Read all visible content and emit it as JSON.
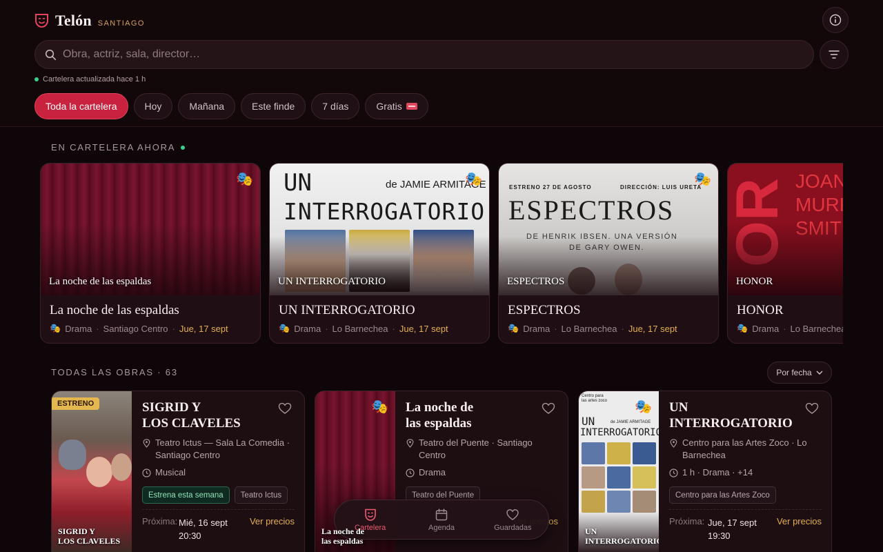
{
  "brand": {
    "name": "Telón",
    "city": "SANTIAGO"
  },
  "search": {
    "placeholder": "Obra, actriz, sala, director…"
  },
  "status": {
    "text": "Cartelera actualizada hace 1 h"
  },
  "filters": [
    {
      "label": "Toda la cartelera",
      "active": true
    },
    {
      "label": "Hoy"
    },
    {
      "label": "Mañana"
    },
    {
      "label": "Este finde"
    },
    {
      "label": "7 días"
    },
    {
      "label": "Gratis"
    }
  ],
  "featured": {
    "heading": "EN CARTELERA AHORA",
    "cards": [
      {
        "poster_title": "La noche de las espaldas",
        "title": "La noche de las espaldas",
        "genre": "Drama",
        "location": "Santiago Centro",
        "date": "Jue, 17 sept"
      },
      {
        "poster_title": "UN INTERROGATORIO",
        "title": "UN INTERROGATORIO",
        "genre": "Drama",
        "location": "Lo Barnechea",
        "date": "Jue, 17 sept",
        "poster_text": {
          "line1": "UN",
          "line2": "INTERROGATORIO",
          "author": "de JAMIE ARMITAGE"
        }
      },
      {
        "poster_title": "ESPECTROS",
        "title": "ESPECTROS",
        "genre": "Drama",
        "location": "Lo Barnechea",
        "date": "Jue, 17 sept",
        "poster_text": {
          "top_left": "ESTRENO 27 DE AGOSTO",
          "top_right": "DIRECCIÓN: LUIS URETA",
          "big": "ESPECTROS",
          "line1": "DE HENRIK IBSEN. UNA VERSIÓN",
          "line2": "DE GARY OWEN."
        }
      },
      {
        "poster_title": "HONOR",
        "title": "HONOR",
        "genre": "Drama",
        "location": "Lo Barnechea",
        "poster_text": {
          "big": "OR",
          "name1": "JOANN",
          "name2": "MURR",
          "name3": "SMITH"
        }
      }
    ]
  },
  "all": {
    "heading": "TODAS LAS OBRAS · 63",
    "sort_label": "Por fecha",
    "cards": [
      {
        "badge": "ESTRENO",
        "poster_title_1": "SIGRID Y",
        "poster_title_2": "LOS CLAVELES",
        "title_1": "SIGRID Y",
        "title_2": "LOS CLAVELES",
        "venue_1": "Teatro Ictus — Sala La Comedia ·",
        "venue_2": "Santiago Centro",
        "extra": "Musical",
        "tags": [
          "Estrena esta semana",
          "Teatro Ictus"
        ],
        "next_label": "Próxima:",
        "next_1": "Mié, 16 sept",
        "next_2": "20:30",
        "prices": "Ver precios"
      },
      {
        "poster_title_1": "La noche de",
        "poster_title_2": "las espaldas",
        "title_1": "La noche de",
        "title_2": "las espaldas",
        "venue_1": "Teatro del Puente · Santiago",
        "venue_2": "Centro",
        "extra": "Drama",
        "tags": [
          "Teatro del Puente"
        ],
        "prices": "Ver precios"
      },
      {
        "poster_title_1": "UN",
        "poster_title_2": "INTERROGATORIO",
        "title_1": "UN",
        "title_2": "INTERROGATORIO",
        "venue_1": "Centro para las Artes Zoco · Lo",
        "venue_2": "Barnechea",
        "extra": "1 h · Drama · +14",
        "tags": [
          "Centro para las Artes Zoco"
        ],
        "next_label": "Próxima:",
        "next_1": "Jue, 17 sept",
        "next_2": "19:30",
        "prices": "Ver precios",
        "poster_text": {
          "small": "Centro para las artes zoco",
          "line1": "UN",
          "author": "de JAMIE ARMITAGE",
          "line2": "INTERROGATORIO"
        }
      }
    ]
  },
  "nav": [
    {
      "label": "Cartelera",
      "active": true
    },
    {
      "label": "Agenda"
    },
    {
      "label": "Guardadas"
    }
  ],
  "colors": {
    "accent": "#c8223e",
    "gold": "#e2b04c",
    "live": "#3ad08a",
    "bg": "#0f0609"
  }
}
